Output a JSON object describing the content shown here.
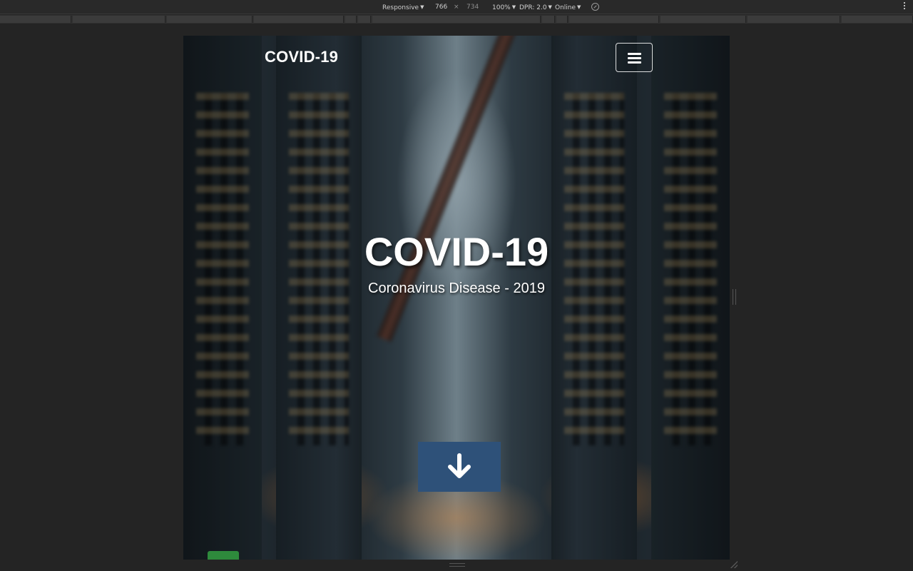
{
  "devtools": {
    "device_mode": "Responsive",
    "width": "766",
    "times": "×",
    "height": "734",
    "zoom": "100%",
    "dpr": "DPR: 2.0",
    "network": "Online",
    "icons": [
      "rotate-icon",
      "more-options-icon"
    ]
  },
  "page": {
    "brand": "COVID-19",
    "hero_title": "COVID-19",
    "hero_subtitle": "Coronavirus Disease - 2019",
    "icons": [
      "hamburger-menu-icon",
      "arrow-down-icon"
    ],
    "colors": {
      "scroll_button": "#2e5179",
      "text": "#ffffff",
      "page_background": "#242424"
    }
  }
}
